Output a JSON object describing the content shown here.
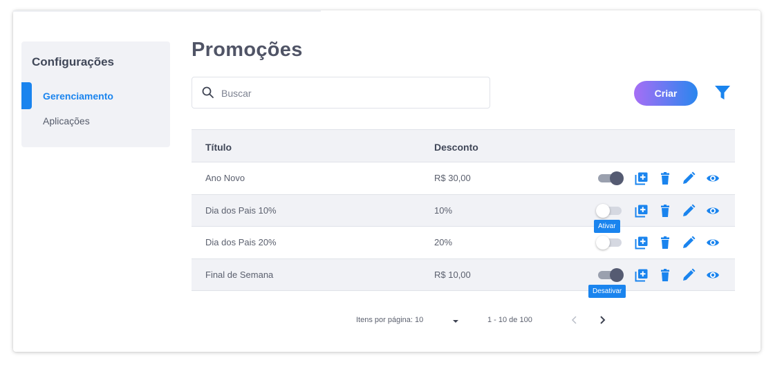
{
  "sidebar": {
    "title": "Configurações",
    "items": [
      {
        "label": "Gerenciamento",
        "active": true
      },
      {
        "label": "Aplicações",
        "active": false
      }
    ]
  },
  "main": {
    "title": "Promoções",
    "search": {
      "placeholder": "Buscar",
      "value": ""
    },
    "create_label": "Criar",
    "table": {
      "columns": [
        "Título",
        "Desconto"
      ],
      "rows": [
        {
          "title": "Ano Novo",
          "discount": "R$ 30,00",
          "active": true
        },
        {
          "title": "Dia dos Pais 10%",
          "discount": "10%",
          "active": false
        },
        {
          "title": "Dia dos Pais 20%",
          "discount": "20%",
          "active": false
        },
        {
          "title": "Final de Semana",
          "discount": "R$ 10,00",
          "active": true
        }
      ]
    },
    "tooltips": {
      "activate": "Ativar",
      "deactivate": "Desativar"
    },
    "pagination": {
      "items_per_page_label": "Itens por página: 10",
      "range": "1 - 10 de 100"
    }
  },
  "colors": {
    "accent": "#1a84ee",
    "gradient_start": "#a66ef5",
    "gradient_end": "#2a86ee",
    "toggle_on": "#555b72"
  },
  "icons": [
    "search-icon",
    "filter-icon",
    "add-box-icon",
    "trash-icon",
    "pencil-icon",
    "eye-icon",
    "chevron-down-icon",
    "chevron-left-icon",
    "chevron-right-icon"
  ]
}
